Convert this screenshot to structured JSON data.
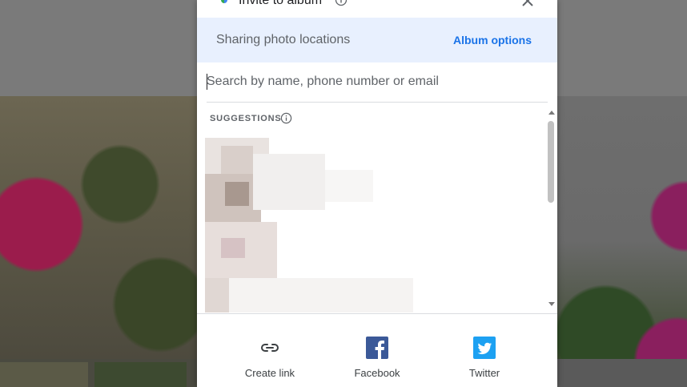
{
  "dialog": {
    "title": "Invite to album",
    "share_bar": {
      "text": "Sharing photo locations",
      "album_options": "Album options"
    },
    "search": {
      "placeholder": "Search by name, phone number or email",
      "value": ""
    },
    "suggestions_label": "SUGGESTIONS",
    "share_targets": [
      {
        "label": "Create link",
        "icon": "link-icon"
      },
      {
        "label": "Facebook",
        "icon": "facebook-icon",
        "color": "#3b5998"
      },
      {
        "label": "Twitter",
        "icon": "twitter-icon",
        "color": "#1da1f2"
      }
    ]
  },
  "colors": {
    "accent": "#1a73e8",
    "share_bar_bg": "#e8f0fe"
  }
}
